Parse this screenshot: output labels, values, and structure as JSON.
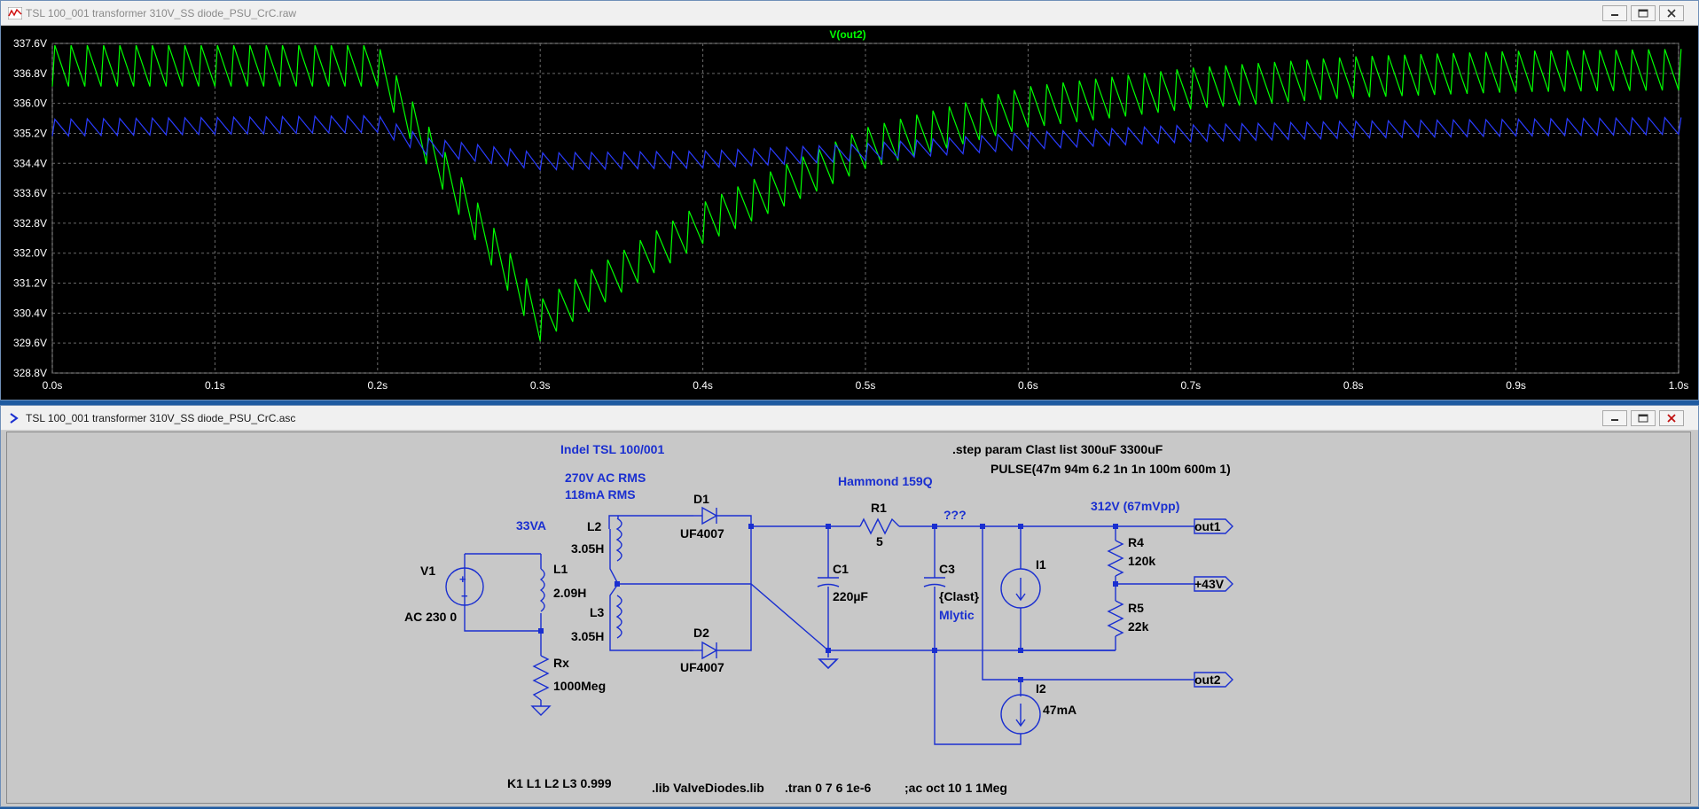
{
  "plot_window": {
    "title": "TSL 100_001 transformer 310V_SS diode_PSU_CrC.raw",
    "trace_label": "V(out2)",
    "y_ticks": [
      "337.6V",
      "336.8V",
      "336.0V",
      "335.2V",
      "334.4V",
      "333.6V",
      "332.8V",
      "332.0V",
      "331.2V",
      "330.4V",
      "329.6V",
      "328.8V"
    ],
    "x_ticks": [
      "0.0s",
      "0.1s",
      "0.2s",
      "0.3s",
      "0.4s",
      "0.5s",
      "0.6s",
      "0.7s",
      "0.8s",
      "0.9s",
      "1.0s"
    ]
  },
  "chart_data": {
    "type": "line",
    "title": "V(out2)",
    "xlim": [
      0,
      1.0
    ],
    "ylim": [
      328.8,
      337.6
    ],
    "grid": true,
    "ripple_period_s": 0.01,
    "series": [
      {
        "color": "#00ff00",
        "ripple_vpp": 1.1,
        "x": [
          0.0,
          0.2,
          0.22,
          0.3,
          0.4,
          0.5,
          0.6,
          0.7,
          0.8,
          0.9,
          1.0
        ],
        "y": [
          337.0,
          337.0,
          335.6,
          330.2,
          332.8,
          334.8,
          335.9,
          336.4,
          336.7,
          336.85,
          336.9
        ]
      },
      {
        "color": "#2a3cff",
        "ripple_vpp": 0.45,
        "x": [
          0.0,
          0.2,
          0.23,
          0.3,
          0.4,
          0.5,
          0.6,
          0.7,
          0.8,
          0.9,
          1.0
        ],
        "y": [
          335.35,
          335.45,
          334.85,
          334.45,
          334.5,
          334.7,
          335.0,
          335.2,
          335.3,
          335.35,
          335.4
        ]
      }
    ]
  },
  "schematic_window": {
    "title": "TSL 100_001 transformer 310V_SS diode_PSU_CrC.asc"
  },
  "schematic": {
    "indel": "Indel TSL 100/001",
    "step": ".step param Clast list   300uF 3300uF",
    "pulse": "PULSE(47m 94m 6.2 1n 1n 100m 600m 1)",
    "v_ac": "270V AC RMS",
    "i_ac": "118mA RMS",
    "hammond": "Hammond 159Q",
    "va": "33VA",
    "d1": "D1",
    "d1_model": "UF4007",
    "d2": "D2",
    "d2_model": "UF4007",
    "l1": "L1",
    "l1_val": "2.09H",
    "l2": "L2",
    "l2_val": "3.05H",
    "l3": "L3",
    "l3_val": "3.05H",
    "v1": "V1",
    "v1_val": "AC 230 0",
    "r1": "R1",
    "r1_val": "5",
    "c1": "C1",
    "c1_val": "220µF",
    "c3": "C3",
    "c3_val": "{Clast}",
    "c3_type": "Mlytic",
    "qmarks": "???",
    "i1": "I1",
    "i2": "I2",
    "i2_val": "47mA",
    "r4": "R4",
    "r4_val": "120k",
    "r5": "R5",
    "r5_val": "22k",
    "rx": "Rx",
    "rx_val": "1000Meg",
    "vout": "312V (67mVpp)",
    "out1": "out1",
    "plus43": "+43V",
    "out2": "out2",
    "k1": "K1 L1 L2 L3  0.999",
    "lib": ".lib ValveDiodes.lib",
    "tran": ".tran 0 7 6 1e-6",
    "ac": ";ac oct 10 1 1Meg"
  }
}
